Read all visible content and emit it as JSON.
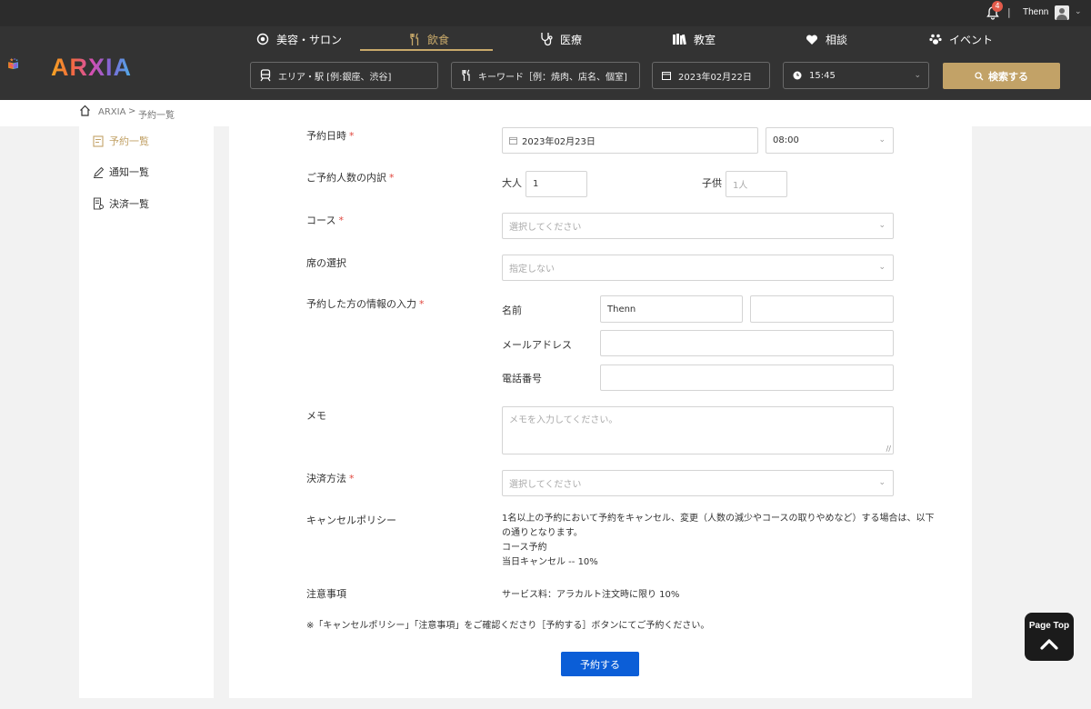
{
  "topbar": {
    "notification_count": "4",
    "separator": "|",
    "username": "Thenn"
  },
  "logo": {
    "text": "ARXIA"
  },
  "categories": [
    {
      "label": "美容・サロン",
      "icon": "salon-icon"
    },
    {
      "label": "飲食",
      "icon": "fork-knife-icon",
      "active": true
    },
    {
      "label": "医療",
      "icon": "stethoscope-icon"
    },
    {
      "label": "教室",
      "icon": "books-icon"
    },
    {
      "label": "相談",
      "icon": "heart-icon"
    },
    {
      "label": "イベント",
      "icon": "paw-icon"
    }
  ],
  "search": {
    "area_placeholder": "エリア・駅 [例:銀座、渋谷]",
    "keyword_placeholder": "キーワード［例：焼肉、店名、個室]",
    "date": "2023年02月22日",
    "time": "15:45",
    "button_label": "検索する"
  },
  "breadcrumb": {
    "home": "ARXIA",
    "separator": ">",
    "current": "予約一覧"
  },
  "sidebar": {
    "items": [
      {
        "label": "予約一覧",
        "icon": "reservation-list-icon",
        "active": true
      },
      {
        "label": "通知一覧",
        "icon": "pencil-icon"
      },
      {
        "label": "決済一覧",
        "icon": "receipt-icon"
      }
    ]
  },
  "form": {
    "required_mark": "*",
    "date_label": "予約日時",
    "date_value": "2023年02月23日",
    "time_value": "08:00",
    "people_label": "ご予約人数の内訳",
    "adult_label": "大人",
    "adult_value": "1",
    "child_label": "子供",
    "child_placeholder": "1人",
    "course_label": "コース",
    "course_placeholder": "選択してください",
    "seat_label": "席の選択",
    "seat_placeholder": "指定しない",
    "info_label": "予約した方の情報の入力",
    "name_label": "名前",
    "first_name_value": "Thenn",
    "last_name_value": "",
    "email_label": "メールアドレス",
    "email_value": "",
    "phone_label": "電話番号",
    "phone_value": "",
    "memo_label": "メモ",
    "memo_placeholder": "メモを入力してください。",
    "payment_label": "決済方法",
    "payment_placeholder": "選択してください",
    "cancel_label": "キャンセルポリシー",
    "cancel_lines": [
      "1名以上の予約において予約をキャンセル、変更（人数の減少やコースの取りやめなど）する場合は、以下",
      "の通りとなります。",
      "コース予約",
      "当日キャンセル -- 10%"
    ],
    "notice_label": "注意事項",
    "notice_value": "サービス料：アラカルト注文時に限り 10%",
    "footnote": "※「キャンセルポリシー」「注意事項」をご確認くださり［予約する］ボタンにてご予約ください。",
    "submit_label": "予約する"
  },
  "page_top": {
    "label": "Page Top"
  },
  "colors": {
    "gold": "#c2a267",
    "primary_blue": "#0b5ed7",
    "required_red": "#e0463d",
    "header_bg": "#333333"
  }
}
